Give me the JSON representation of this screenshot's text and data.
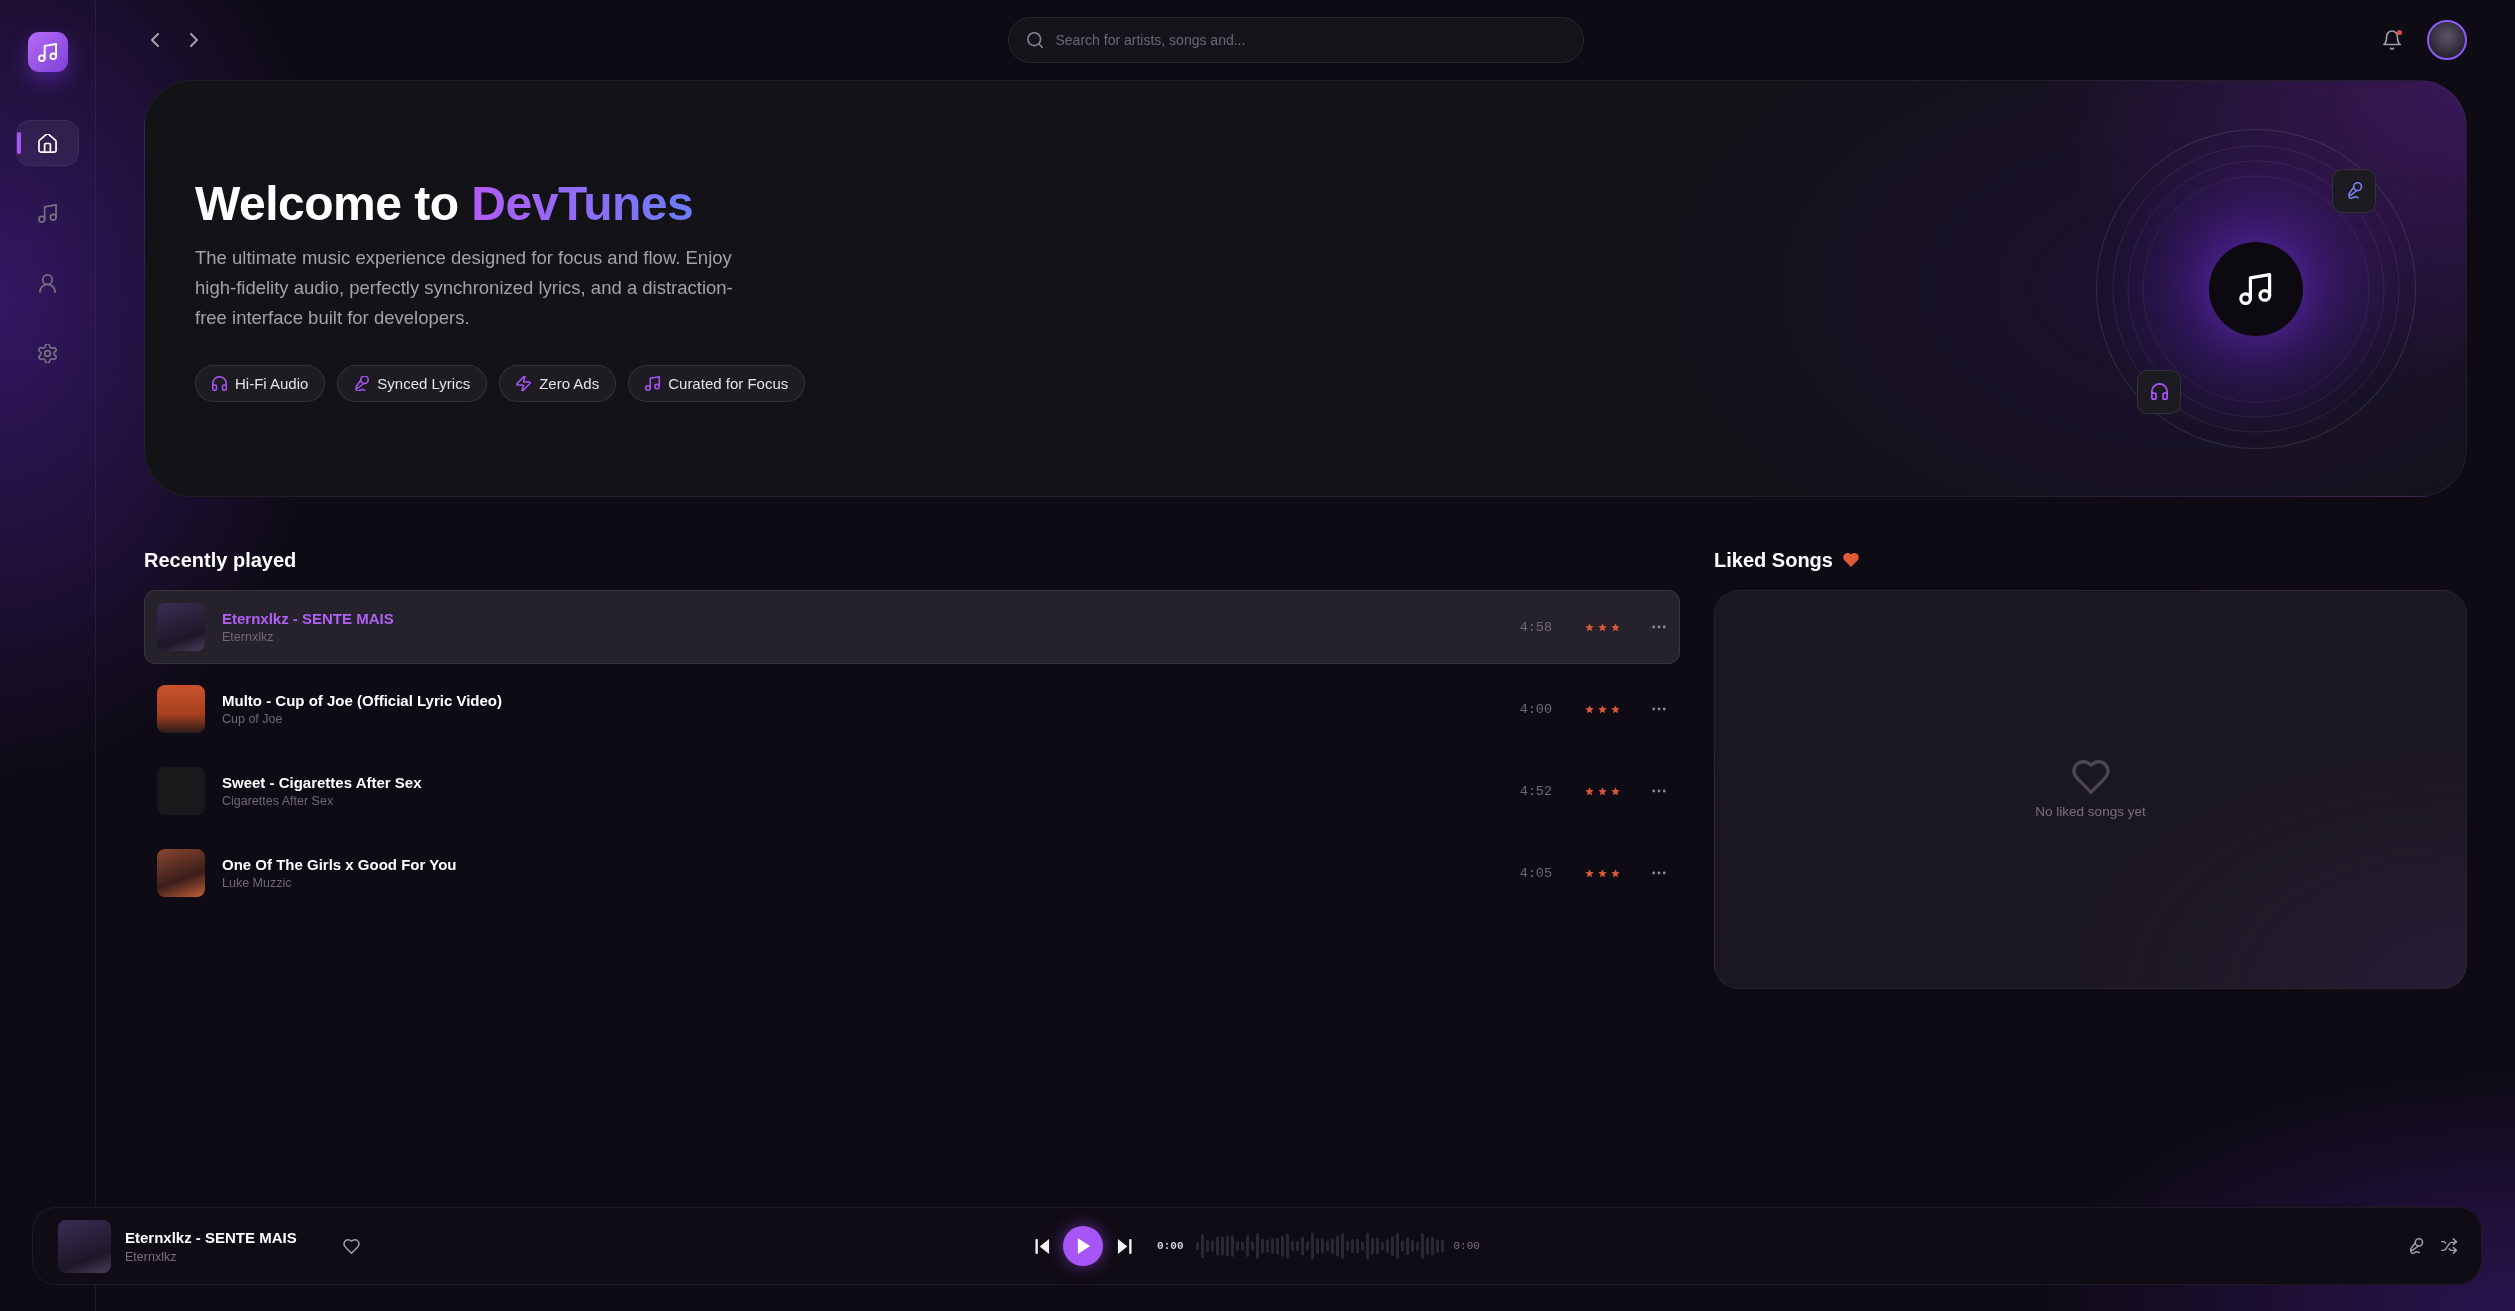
{
  "sidebar": {
    "items": [
      {
        "selected": true
      },
      {
        "selected": false
      },
      {
        "selected": false
      },
      {
        "selected": false
      }
    ]
  },
  "topbar": {
    "search": {
      "placeholder": "Search for artists, songs and..."
    },
    "notifications_unread": true
  },
  "hero": {
    "title": "Welcome to",
    "title_highlight": "DevTunes",
    "description": "The ultimate music experience designed for focus and flow. Enjoy high-fidelity audio, perfectly synchronized lyrics, and a distraction-free interface built for developers.",
    "features": [
      "Hi-Fi Audio",
      "Synced Lyrics",
      "Zero Ads",
      "Curated for Focus"
    ]
  },
  "recently_played": {
    "title": "Recently played",
    "tracks": [
      {
        "title": "Eternxlkz - SENTE MAIS",
        "artist": "Eternxlkz",
        "duration": "4:58",
        "stars": 3,
        "selected": true
      },
      {
        "title": "Multo - Cup of Joe (Official Lyric Video)",
        "artist": "Cup of Joe",
        "duration": "4:00",
        "stars": 3,
        "selected": false
      },
      {
        "title": "Sweet - Cigarettes After Sex",
        "artist": "Cigarettes After Sex",
        "duration": "4:52",
        "stars": 3,
        "selected": false
      },
      {
        "title": "One Of The Girls x Good For You",
        "artist": "Luke Muzzic",
        "duration": "4:05",
        "stars": 3,
        "selected": false
      }
    ]
  },
  "liked_songs": {
    "title": "Liked Songs",
    "empty_text": "No liked songs yet"
  },
  "player": {
    "title": "Eternxlkz - SENTE MAIS",
    "artist": "Eternxlkz",
    "liked": false,
    "playing": false,
    "elapsed": "0:00",
    "total": "0:00"
  }
}
